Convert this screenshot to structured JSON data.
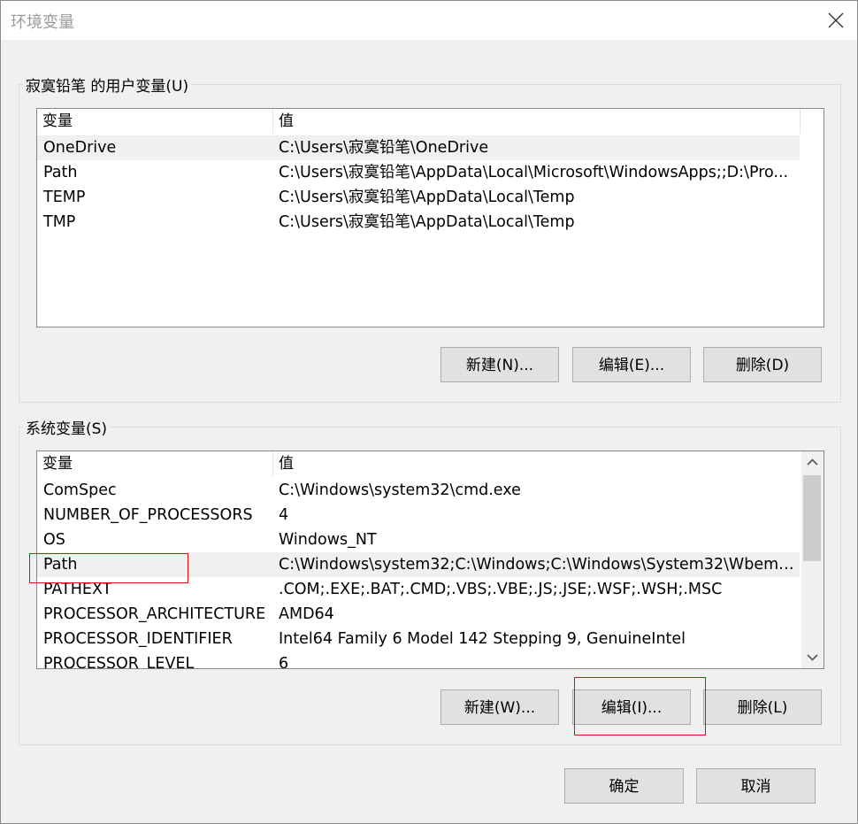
{
  "window": {
    "title": "环境变量"
  },
  "user_vars": {
    "group_label": "寂寞铅笔 的用户变量(U)",
    "columns": [
      "变量",
      "值"
    ],
    "rows": [
      {
        "name": "OneDrive",
        "value": "C:\\Users\\寂寞铅笔\\OneDrive"
      },
      {
        "name": "Path",
        "value": "C:\\Users\\寂寞铅笔\\AppData\\Local\\Microsoft\\WindowsApps;;D:\\Pro..."
      },
      {
        "name": "TEMP",
        "value": "C:\\Users\\寂寞铅笔\\AppData\\Local\\Temp"
      },
      {
        "name": "TMP",
        "value": "C:\\Users\\寂寞铅笔\\AppData\\Local\\Temp"
      }
    ],
    "buttons": {
      "new": "新建(N)...",
      "edit": "编辑(E)...",
      "delete": "删除(D)"
    }
  },
  "system_vars": {
    "group_label": "系统变量(S)",
    "columns": [
      "变量",
      "值"
    ],
    "rows": [
      {
        "name": "ComSpec",
        "value": "C:\\Windows\\system32\\cmd.exe"
      },
      {
        "name": "NUMBER_OF_PROCESSORS",
        "value": "4"
      },
      {
        "name": "OS",
        "value": "Windows_NT"
      },
      {
        "name": "Path",
        "value": "C:\\Windows\\system32;C:\\Windows;C:\\Windows\\System32\\Wbem;..."
      },
      {
        "name": "PATHEXT",
        "value": ".COM;.EXE;.BAT;.CMD;.VBS;.VBE;.JS;.JSE;.WSF;.WSH;.MSC"
      },
      {
        "name": "PROCESSOR_ARCHITECTURE",
        "value": "AMD64"
      },
      {
        "name": "PROCESSOR_IDENTIFIER",
        "value": "Intel64 Family 6 Model 142 Stepping 9, GenuineIntel"
      },
      {
        "name": "PROCESSOR_LEVEL",
        "value": "6"
      }
    ],
    "buttons": {
      "new": "新建(W)...",
      "edit": "编辑(I)...",
      "delete": "删除(L)"
    }
  },
  "footer": {
    "ok": "确定",
    "cancel": "取消"
  },
  "colors": {
    "selected_row": "#f0f0f0",
    "highlight_box": "#e01010",
    "button_face": "#e1e1e1"
  }
}
